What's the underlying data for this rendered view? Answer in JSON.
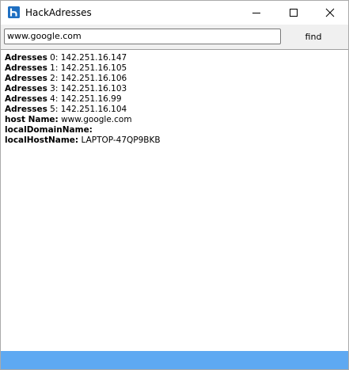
{
  "window": {
    "title": "HackAdresses",
    "icon": "hack-app-icon",
    "controls": [
      "minimize-icon",
      "maximize-icon",
      "close-icon"
    ]
  },
  "search": {
    "value": "www.google.com",
    "button_label": "find"
  },
  "results": [
    {
      "label": "Adresses",
      "suffix": " 0:",
      "value": " 142.251.16.147"
    },
    {
      "label": "Adresses",
      "suffix": " 1:",
      "value": " 142.251.16.105"
    },
    {
      "label": "Adresses",
      "suffix": " 2:",
      "value": " 142.251.16.106"
    },
    {
      "label": "Adresses",
      "suffix": " 3:",
      "value": " 142.251.16.103"
    },
    {
      "label": "Adresses",
      "suffix": " 4:",
      "value": " 142.251.16.99"
    },
    {
      "label": "Adresses",
      "suffix": " 5:",
      "value": " 142.251.16.104"
    },
    {
      "label": "host Name:",
      "suffix": "",
      "value": " www.google.com"
    },
    {
      "label": "localDomainName:",
      "suffix": "",
      "value": ""
    },
    {
      "label": "localHostName:",
      "suffix": "",
      "value": " LAPTOP-47QP9BKB"
    }
  ],
  "colors": {
    "accent": "#1e6fc2",
    "statusbar": "#5ea9f2"
  }
}
